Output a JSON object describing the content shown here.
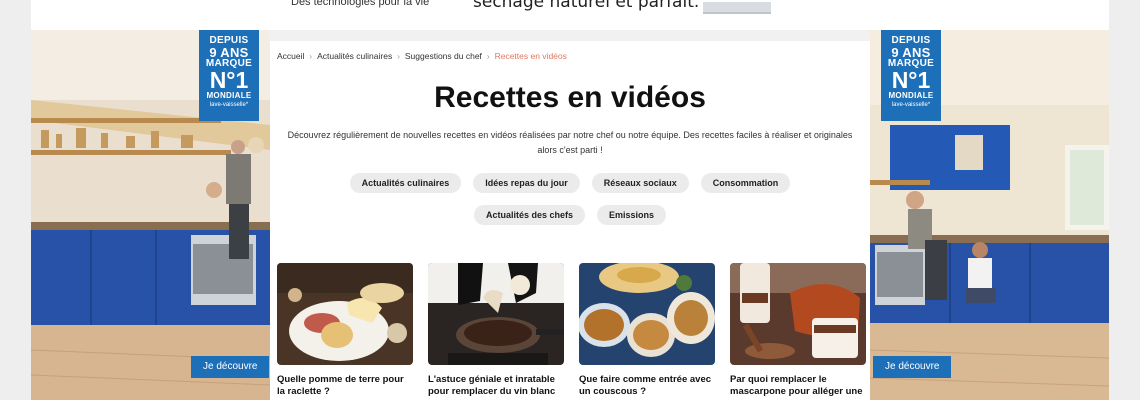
{
  "top_banner": {
    "left_text": "Des technologies pour la vie",
    "center_text": "séchage naturel et parfait."
  },
  "ads": {
    "left": {
      "badge_line1": "DEPUIS",
      "badge_line2": "9 ANS",
      "badge_line3": "MARQUE",
      "badge_line4": "N°1",
      "badge_line5": "MONDIALE",
      "badge_line6": "lave-vaisselle*",
      "button_label": "Je découvre"
    },
    "right": {
      "badge_line1": "DEPUIS",
      "badge_line2": "9 ANS",
      "badge_line3": "MARQUE",
      "badge_line4": "N°1",
      "badge_line5": "MONDIALE",
      "badge_line6": "lave-vaisselle*",
      "button_label": "Je découvre"
    }
  },
  "breadcrumb": [
    "Accueil",
    "Actualités culinaires",
    "Suggestions du chef",
    "Recettes en vidéos"
  ],
  "page_title": "Recettes en vidéos",
  "intro": "Découvrez régulièrement de nouvelles recettes en vidéos réalisées par notre chef ou notre équipe. Des recettes faciles à réaliser et originales alors c'est parti !",
  "tags": [
    "Actualités culinaires",
    "Idées repas du jour",
    "Réseaux sociaux",
    "Consommation",
    "Actualités des chefs",
    "Emissions"
  ],
  "cards": [
    {
      "title": "Quelle pomme de terre pour la raclette ?"
    },
    {
      "title": "L'astuce géniale et inratable pour remplacer du vin blanc"
    },
    {
      "title": "Que faire comme entrée avec un couscous ?"
    },
    {
      "title": "Par quoi remplacer le mascarpone pour alléger une"
    }
  ],
  "colors": {
    "accent_blue": "#1d6fb8",
    "breadcrumb_current": "#e07860",
    "tag_bg": "#ebebeb"
  }
}
